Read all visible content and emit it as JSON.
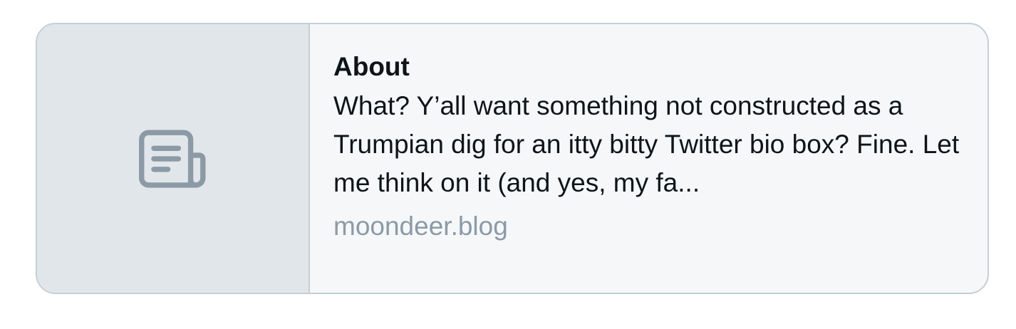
{
  "link_card": {
    "title": "About",
    "description": "What? Y’all want something not constructed as a Trumpian dig for an itty bitty Twitter bio box? Fine. Let me think on it (and yes, my fa...",
    "domain": "moondeer.blog",
    "thumbnail_icon": "newspaper-icon",
    "colors": {
      "border": "#c4cfd6",
      "thumbnail_bg": "#e1e6ea",
      "card_bg": "#f5f7f9",
      "icon": "#8c9aa6",
      "text": "#0f1419",
      "muted_text": "#8c9aa6"
    }
  }
}
